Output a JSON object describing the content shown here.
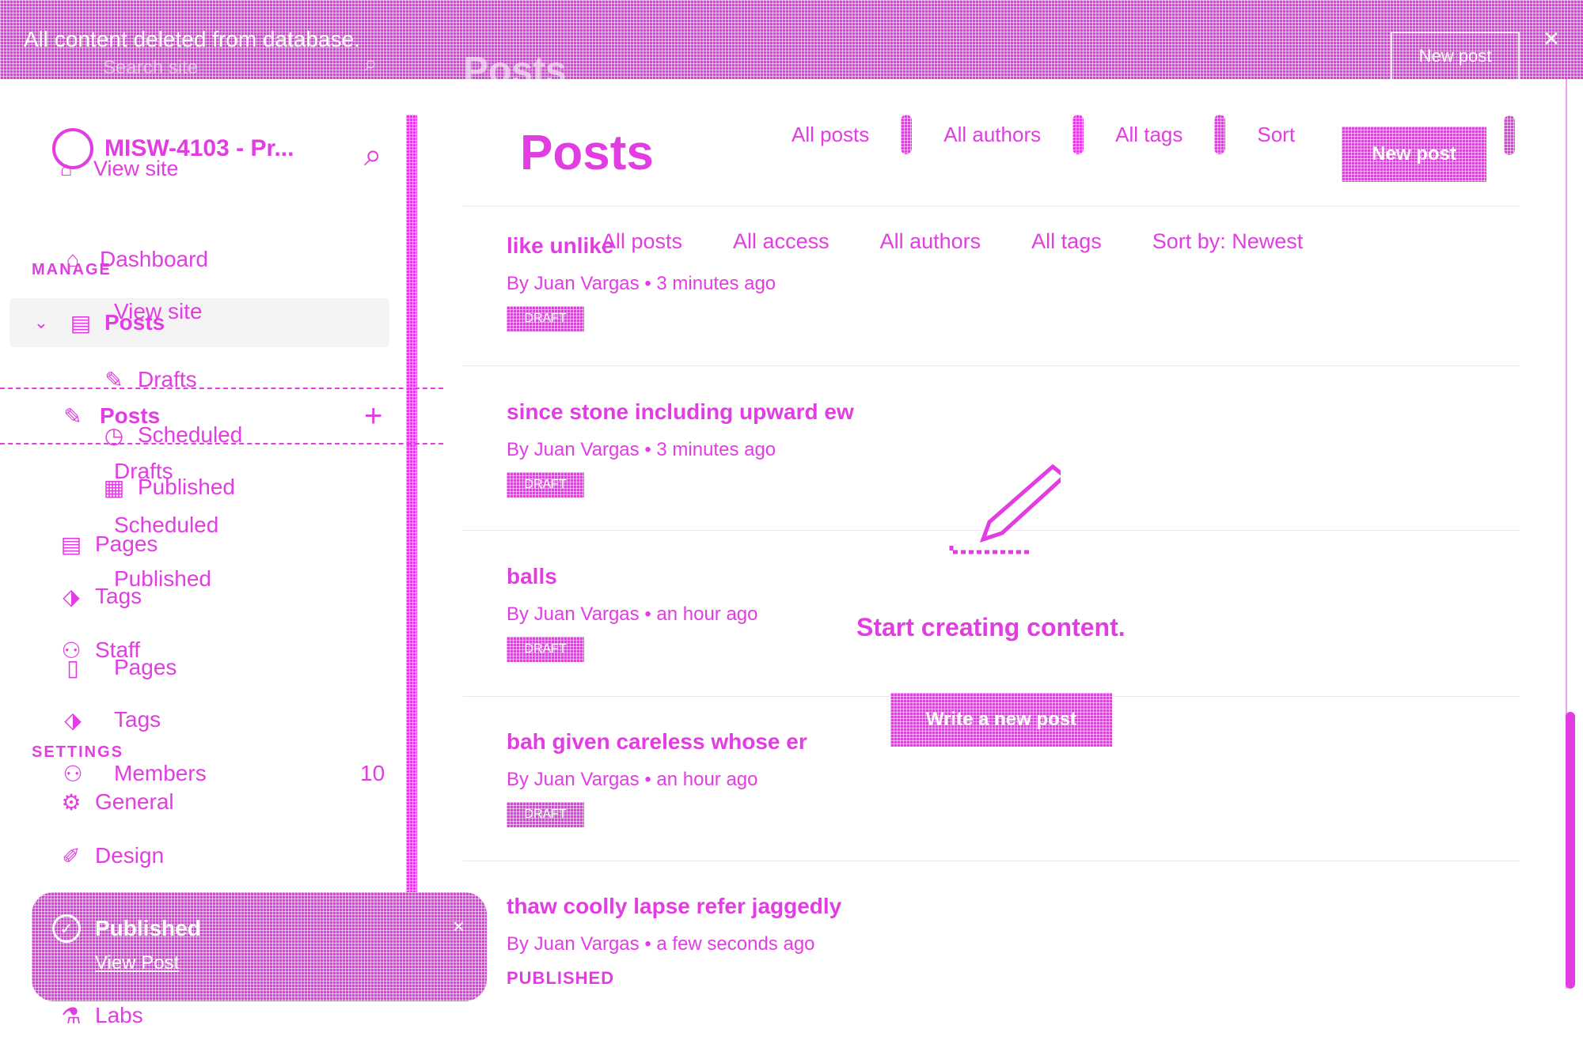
{
  "notification": {
    "message": "All content deleted from database.",
    "close": "×"
  },
  "ghost": {
    "new_post": "New post",
    "title": "Posts",
    "search_placeholder": "Search site"
  },
  "sidebar": {
    "site_name": "MISW-4103 - Pr...",
    "view_site_top": "View site",
    "manage_label": "MANAGE",
    "settings_label": "SETTINGS",
    "items": [
      {
        "label": "Dashboard"
      },
      {
        "label": "View site"
      },
      {
        "label": "Posts"
      },
      {
        "label": "Posts"
      },
      {
        "label": "Drafts"
      },
      {
        "label": "Scheduled"
      },
      {
        "label": "Published"
      },
      {
        "label": "Drafts"
      },
      {
        "label": "Scheduled"
      },
      {
        "label": "Published"
      },
      {
        "label": "Pages"
      },
      {
        "label": "Tags"
      },
      {
        "label": "Staff"
      },
      {
        "label": "Pages"
      },
      {
        "label": "Tags"
      },
      {
        "label": "Members",
        "count": "10"
      },
      {
        "label": "General"
      },
      {
        "label": "Design"
      },
      {
        "label": "Labs"
      }
    ]
  },
  "topbar": {
    "filters": [
      "All posts",
      "All authors",
      "All tags",
      "Sort"
    ],
    "new_post": "New post"
  },
  "main": {
    "title": "Posts",
    "filters": [
      "All posts",
      "All access",
      "All authors",
      "All tags",
      "Sort by: Newest"
    ],
    "posts": [
      {
        "title": "like unlike",
        "meta": "By Juan Vargas • 3 minutes ago",
        "badge": "DRAFT"
      },
      {
        "title": "since stone including upward ew",
        "meta": "By Juan Vargas • 3 minutes ago",
        "badge": "DRAFT"
      },
      {
        "title": "balls",
        "meta": "By Juan Vargas • an hour ago",
        "badge": "DRAFT"
      },
      {
        "title": "bah given careless whose er",
        "meta": "By Juan Vargas • an hour ago",
        "badge": "DRAFT"
      },
      {
        "title": "thaw coolly lapse refer jaggedly",
        "meta": "By Juan Vargas • a few seconds ago",
        "status": "PUBLISHED"
      }
    ],
    "empty_title": "Start creating content.",
    "write_button": "Write a new post"
  },
  "toast": {
    "title": "Published",
    "link": "View Post",
    "close": "×"
  },
  "colors": {
    "accent": "#e23de2"
  }
}
